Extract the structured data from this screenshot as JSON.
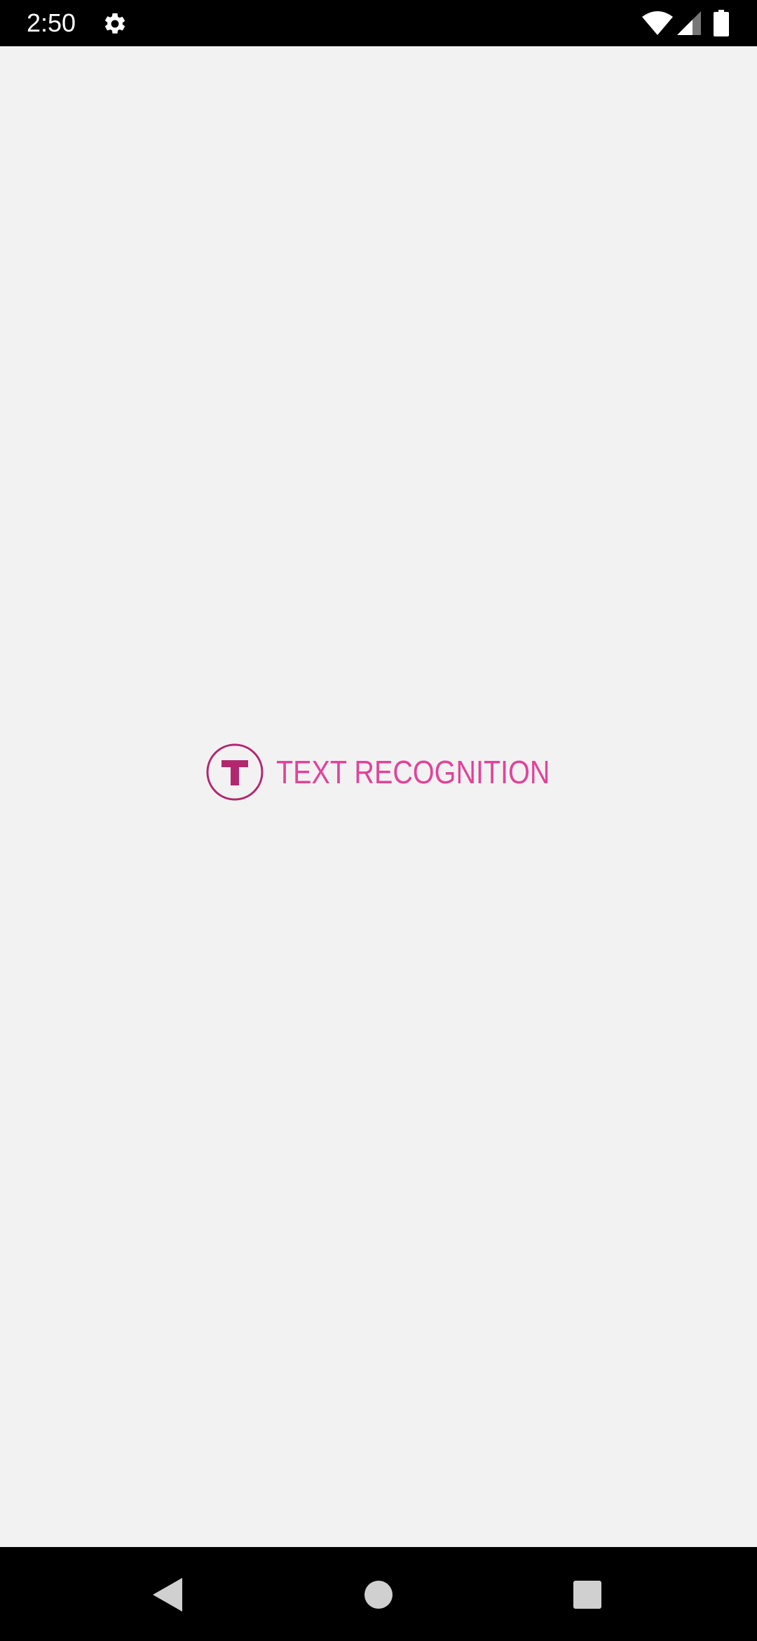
{
  "status_bar": {
    "time": "2:50",
    "icons": [
      "settings-gear-icon",
      "wifi-icon",
      "cellular-signal-icon",
      "battery-icon"
    ]
  },
  "splash": {
    "logo_letter": "T",
    "app_name": "TEXT RECOGNITION",
    "accent_color": "#e0449a",
    "logo_color": "#b3276f"
  },
  "nav_bar": {
    "icons": [
      "back-icon",
      "home-icon",
      "recents-icon"
    ]
  }
}
